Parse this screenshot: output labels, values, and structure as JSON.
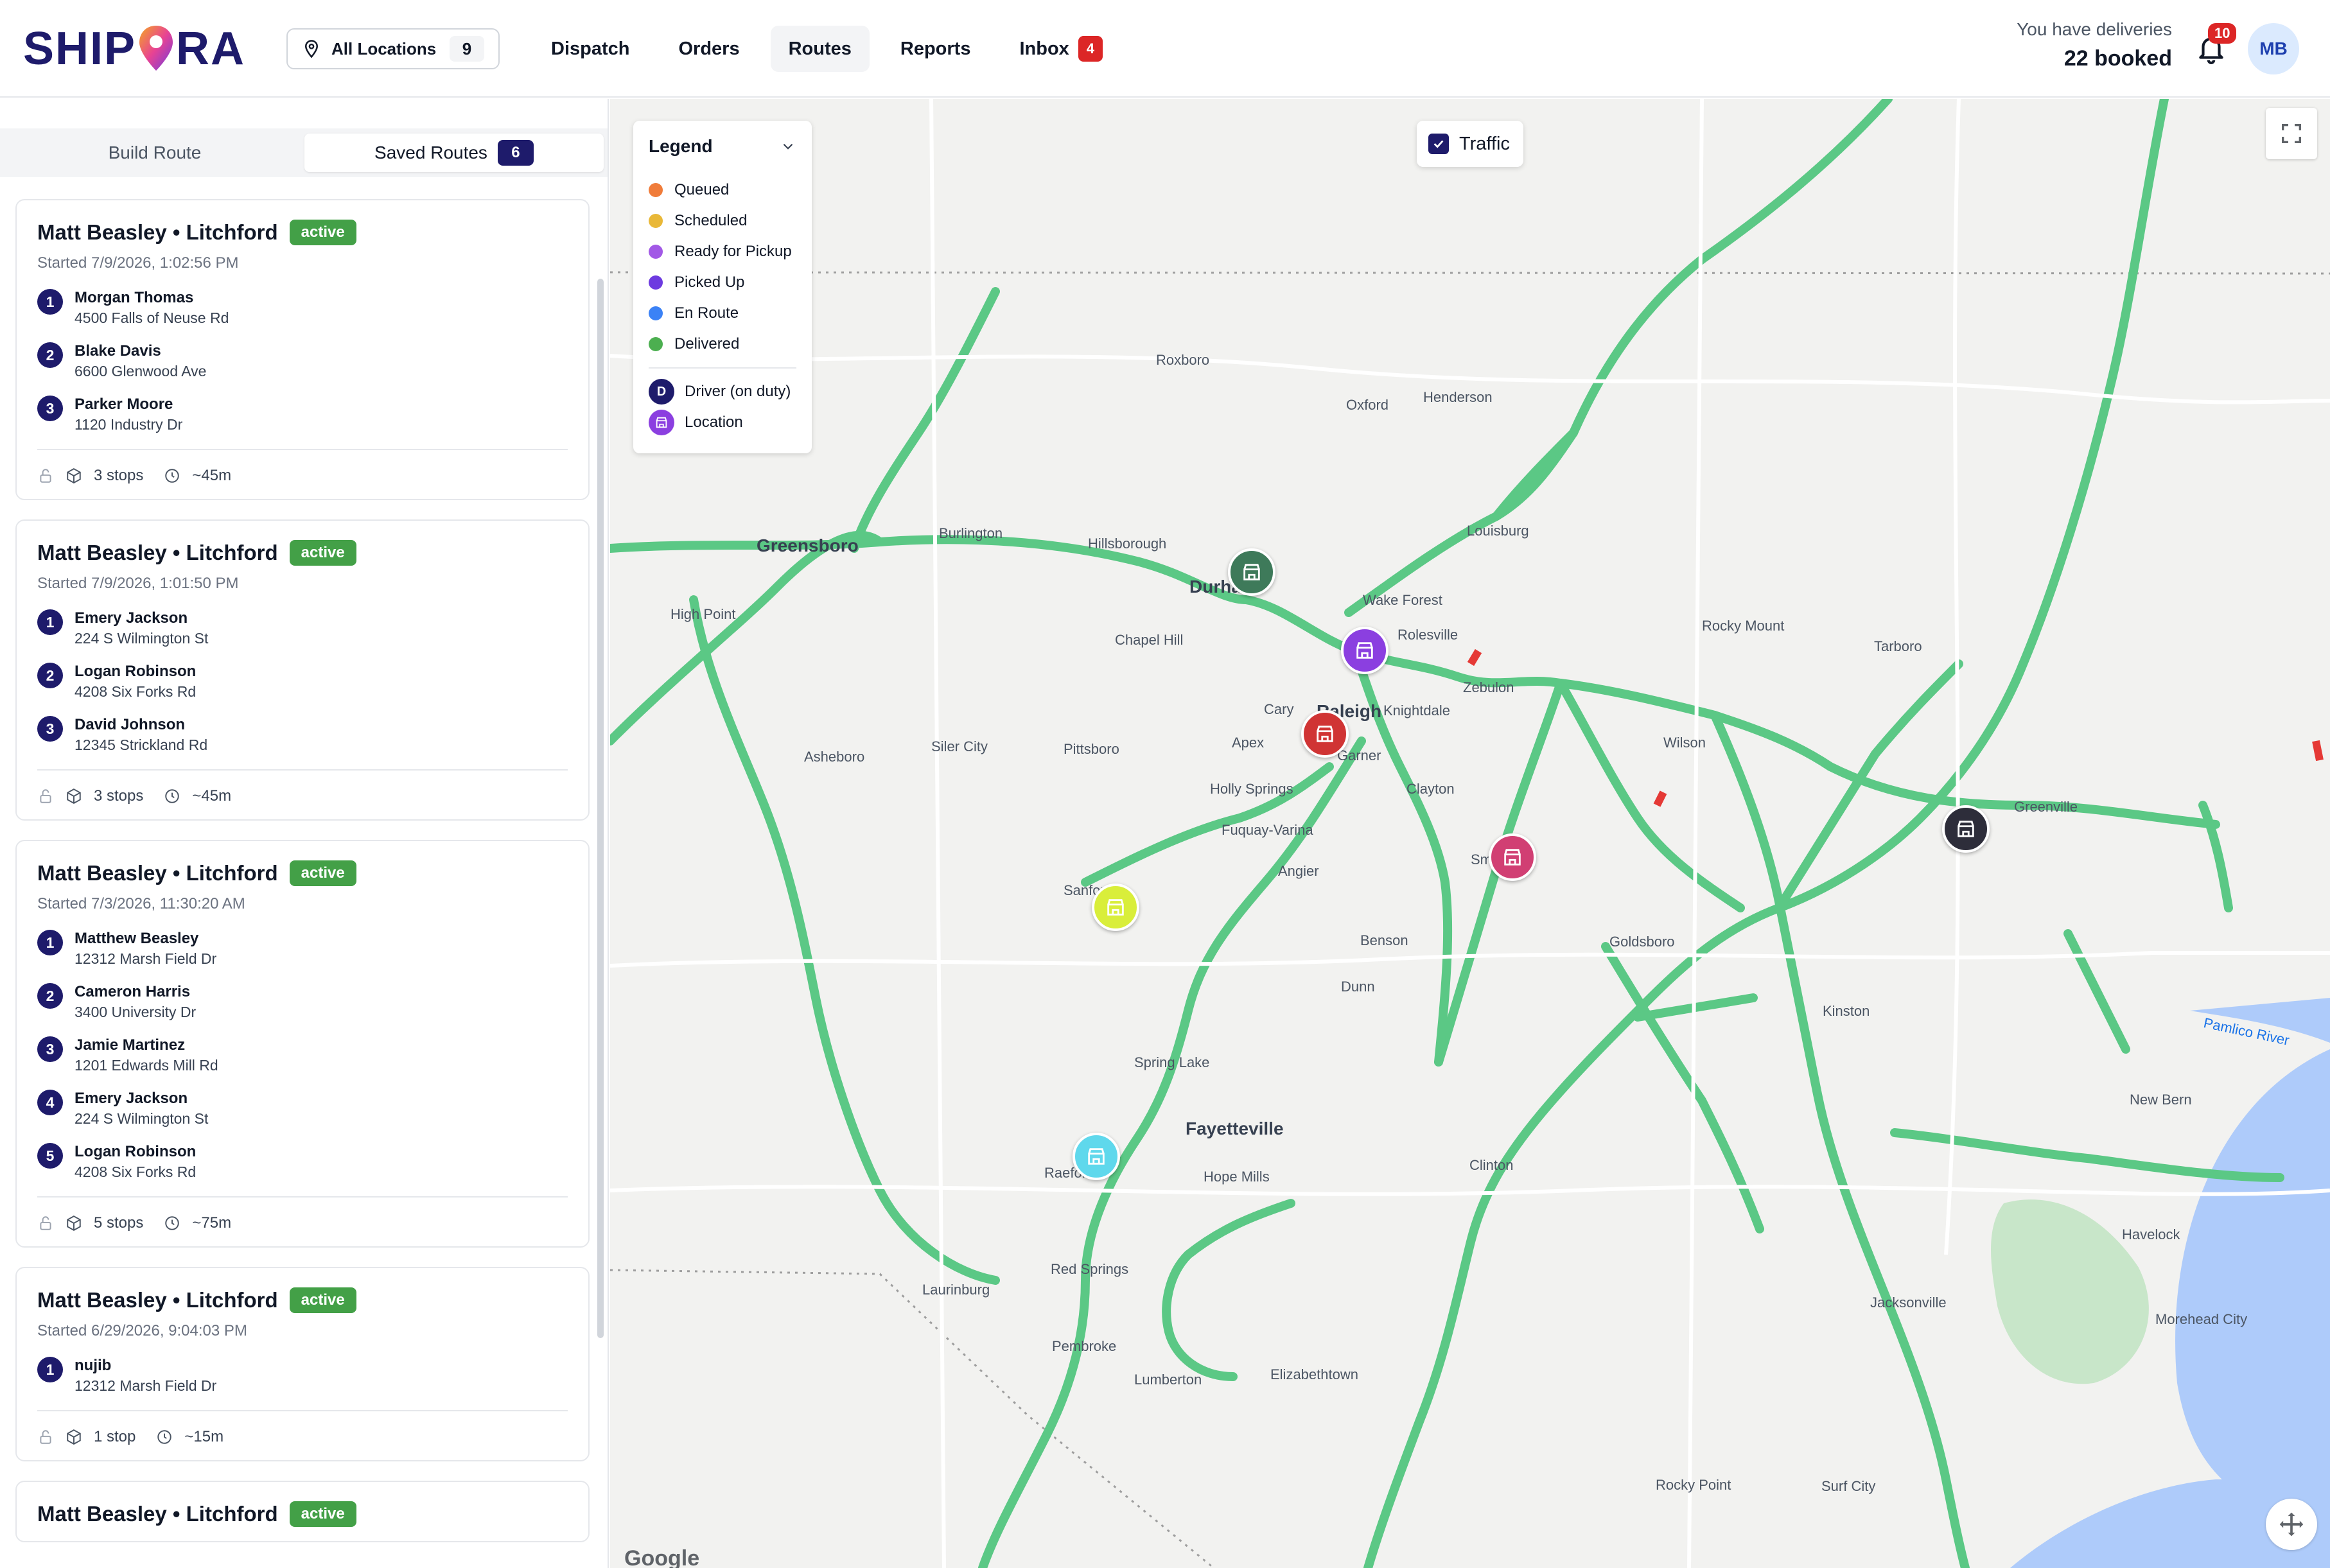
{
  "brand": {
    "name_left": "SHIP",
    "name_right": "RA"
  },
  "location_selector": {
    "label": "All Locations",
    "count": "9"
  },
  "nav": [
    {
      "label": "Dispatch",
      "active": false
    },
    {
      "label": "Orders",
      "active": false
    },
    {
      "label": "Routes",
      "active": true
    },
    {
      "label": "Reports",
      "active": false
    },
    {
      "label": "Inbox",
      "active": false,
      "badge": "4"
    }
  ],
  "deliveries": {
    "line1": "You have deliveries",
    "line2": "22 booked"
  },
  "notifications": {
    "count": "10"
  },
  "user": {
    "initials": "MB"
  },
  "sidebar": {
    "tabs": [
      {
        "label": "Build Route",
        "active": false
      },
      {
        "label": "Saved Routes",
        "active": true,
        "count": "6"
      }
    ],
    "routes": [
      {
        "title": "Matt Beasley • Litchford",
        "status": "active",
        "started": "Started 7/9/2026, 1:02:56 PM",
        "stops": [
          {
            "n": "1",
            "name": "Morgan Thomas",
            "addr": "4500 Falls of Neuse Rd"
          },
          {
            "n": "2",
            "name": "Blake Davis",
            "addr": "6600 Glenwood Ave"
          },
          {
            "n": "3",
            "name": "Parker Moore",
            "addr": "1120 Industry Dr"
          }
        ],
        "stop_count": "3 stops",
        "duration": "~45m"
      },
      {
        "title": "Matt Beasley • Litchford",
        "status": "active",
        "started": "Started 7/9/2026, 1:01:50 PM",
        "stops": [
          {
            "n": "1",
            "name": "Emery Jackson",
            "addr": "224 S Wilmington St"
          },
          {
            "n": "2",
            "name": "Logan Robinson",
            "addr": "4208 Six Forks Rd"
          },
          {
            "n": "3",
            "name": "David Johnson",
            "addr": "12345 Strickland Rd"
          }
        ],
        "stop_count": "3 stops",
        "duration": "~45m"
      },
      {
        "title": "Matt Beasley • Litchford",
        "status": "active",
        "started": "Started 7/3/2026, 11:30:20 AM",
        "stops": [
          {
            "n": "1",
            "name": "Matthew Beasley",
            "addr": "12312 Marsh Field Dr"
          },
          {
            "n": "2",
            "name": "Cameron Harris",
            "addr": "3400 University Dr"
          },
          {
            "n": "3",
            "name": "Jamie Martinez",
            "addr": "1201 Edwards Mill Rd"
          },
          {
            "n": "4",
            "name": "Emery Jackson",
            "addr": "224 S Wilmington St"
          },
          {
            "n": "5",
            "name": "Logan Robinson",
            "addr": "4208 Six Forks Rd"
          }
        ],
        "stop_count": "5 stops",
        "duration": "~75m"
      },
      {
        "title": "Matt Beasley • Litchford",
        "status": "active",
        "started": "Started 6/29/2026, 9:04:03 PM",
        "stops": [
          {
            "n": "1",
            "name": "nujib",
            "addr": "12312 Marsh Field Dr"
          }
        ],
        "stop_count": "1 stop",
        "duration": "~15m"
      },
      {
        "title": "Matt Beasley • Litchford",
        "status": "active"
      }
    ]
  },
  "legend": {
    "title": "Legend",
    "statuses": [
      {
        "label": "Queued",
        "color": "#f07c3a"
      },
      {
        "label": "Scheduled",
        "color": "#e9b838"
      },
      {
        "label": "Ready for Pickup",
        "color": "#a259e6"
      },
      {
        "label": "Picked Up",
        "color": "#6d3be0"
      },
      {
        "label": "En Route",
        "color": "#3b82f6"
      },
      {
        "label": "Delivered",
        "color": "#4caf50"
      }
    ],
    "driver_label": "Driver (on duty)",
    "driver_initial": "D",
    "location_label": "Location"
  },
  "traffic": {
    "label": "Traffic",
    "checked": true
  },
  "map": {
    "attribution": "Google",
    "cities": [
      {
        "name": "Greensboro",
        "big": true
      },
      {
        "name": "Durham",
        "big": true
      },
      {
        "name": "Raleigh",
        "big": true
      },
      {
        "name": "Fayetteville",
        "big": true
      },
      {
        "name": "Chapel Hill"
      },
      {
        "name": "Cary"
      },
      {
        "name": "Apex"
      },
      {
        "name": "Garner"
      },
      {
        "name": "Wake Forest"
      },
      {
        "name": "Rolesville"
      },
      {
        "name": "Knightdale"
      },
      {
        "name": "Zebulon"
      },
      {
        "name": "Clayton"
      },
      {
        "name": "Smithfield"
      },
      {
        "name": "Sanford"
      },
      {
        "name": "Dunn"
      },
      {
        "name": "Benson"
      },
      {
        "name": "Wilson"
      },
      {
        "name": "Rocky Mount"
      },
      {
        "name": "Tarboro"
      },
      {
        "name": "Greenville"
      },
      {
        "name": "Goldsboro"
      },
      {
        "name": "Kinston"
      },
      {
        "name": "New Bern"
      },
      {
        "name": "Jacksonville"
      },
      {
        "name": "Havelock"
      },
      {
        "name": "Morehead City"
      },
      {
        "name": "Lumberton"
      },
      {
        "name": "Pembroke"
      },
      {
        "name": "Laurinburg"
      },
      {
        "name": "Hillsborough"
      },
      {
        "name": "Burlington"
      },
      {
        "name": "Oxford"
      },
      {
        "name": "Henderson"
      },
      {
        "name": "Roxboro"
      },
      {
        "name": "Louisburg"
      },
      {
        "name": "Rocky Point"
      },
      {
        "name": "Surf City"
      },
      {
        "name": "Clinton"
      },
      {
        "name": "Elizabethtown"
      },
      {
        "name": "Red Springs"
      },
      {
        "name": "Raeford"
      },
      {
        "name": "Spring Lake"
      },
      {
        "name": "Hope Mills"
      },
      {
        "name": "Angier"
      },
      {
        "name": "Fuquay-Varina"
      },
      {
        "name": "Holly Springs"
      },
      {
        "name": "Pittsboro"
      },
      {
        "name": "Siler City"
      },
      {
        "name": "Asheboro"
      },
      {
        "name": "High Point"
      },
      {
        "name": "Pamlico River"
      }
    ]
  }
}
